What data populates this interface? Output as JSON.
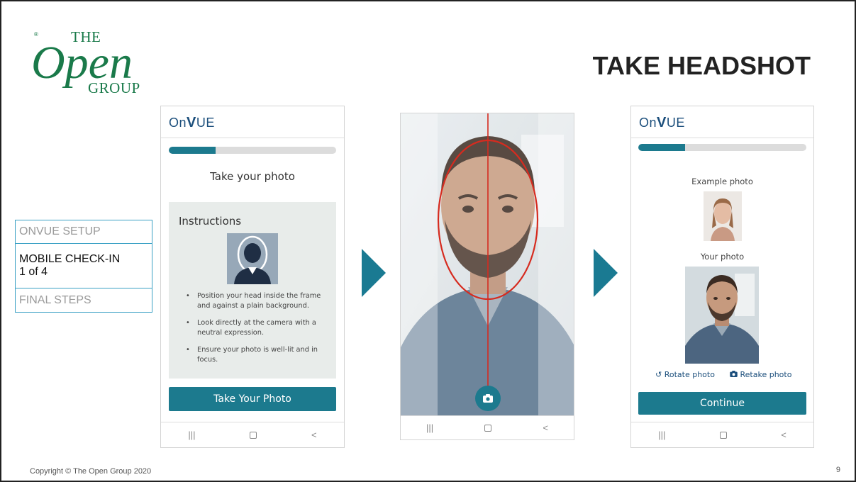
{
  "logo": {
    "reg": "®",
    "the": "THE",
    "open": "Open",
    "group": "GROUP"
  },
  "slide_title": "TAKE HEADSHOT",
  "steps": [
    {
      "label": "ONVUE SETUP"
    },
    {
      "label": "MOBILE CHECK-IN",
      "sub": "1 of 4"
    },
    {
      "label": "FINAL STEPS"
    }
  ],
  "left_phone": {
    "brand_on": "On",
    "brand_v": "V",
    "brand_ue": "UE",
    "progress": 0.28,
    "title": "Take your photo",
    "instructions_title": "Instructions",
    "instructions": [
      "Position your head inside the frame and against a plain background.",
      "Look directly at the camera with a neutral expression.",
      "Ensure your photo is well-lit and in focus."
    ],
    "button": "Take Your Photo"
  },
  "right_phone": {
    "brand_on": "On",
    "brand_v": "V",
    "brand_ue": "UE",
    "progress": 0.28,
    "example_label": "Example photo",
    "your_label": "Your photo",
    "rotate": "Rotate photo",
    "retake": "Retake photo",
    "button": "Continue"
  },
  "navbar": {
    "recent": "|||",
    "back": "<"
  },
  "colors": {
    "accent": "#1c7a8e",
    "brand_green": "#1a7a4a",
    "arrow": "#1a7a92",
    "oval": "#d62b1f"
  },
  "footer": "Copyright © The Open Group 2020",
  "page_number": "9"
}
